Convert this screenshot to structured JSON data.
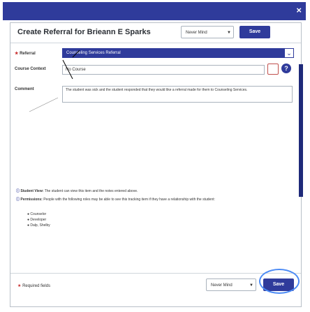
{
  "window": {
    "close_glyph": "×"
  },
  "dialog": {
    "title": "Create Referral for Brieann E Sparks",
    "header_select_value": "Never Mind",
    "header_save_label": "Save"
  },
  "form": {
    "referral_label": "Referral",
    "referral_value": "Counseling Services Referral",
    "course_label": "Course Context",
    "course_value": "No Course",
    "help_glyph": "?",
    "comment_label": "Comment",
    "comment_value": "The student was sick and the student responded that they would like a referral made for them to Counseling Services."
  },
  "info": {
    "student_view_label": "Student View:",
    "student_view_text": "The student can view this item and the notes entered above.",
    "permissions_label": "Permissions:",
    "permissions_text": "People with the following roles may be able to see this tracking item if they have a relationship with the student:",
    "roles": [
      "Counselor",
      "Developer",
      "Dalp, Shelby"
    ]
  },
  "footer": {
    "required_label": "Required fields",
    "select_value": "Never Mind",
    "save_label": "Save"
  },
  "colors": {
    "accent": "#2f3b9b",
    "highlight": "#4c8bf5"
  }
}
